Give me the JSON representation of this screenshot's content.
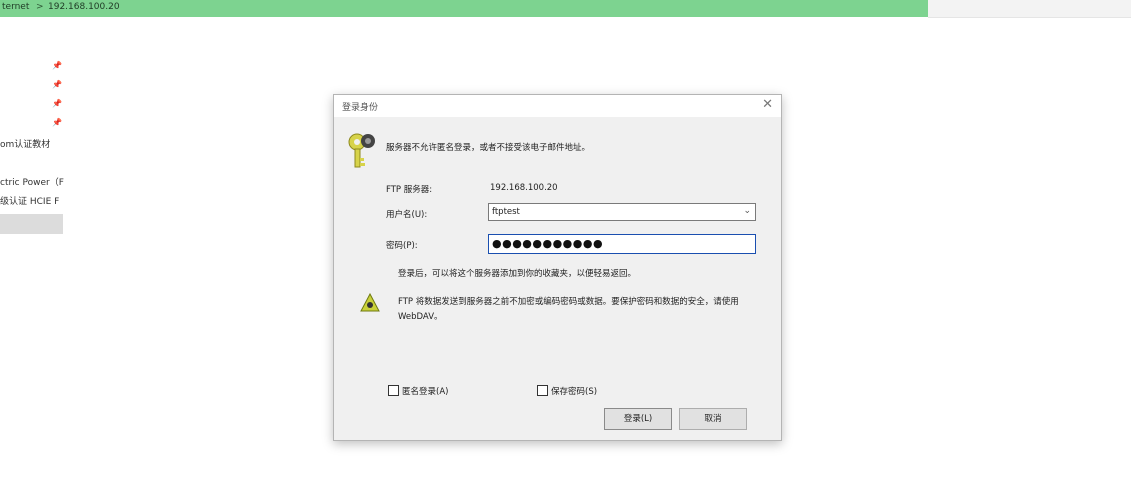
{
  "explorer": {
    "breadcrumb": "ternet",
    "separator": ">",
    "address": "192.168.100.20",
    "nav": [
      {
        "label": "om认证教材"
      },
      {
        "label": "ctric Power（F"
      },
      {
        "label": "级认证 HCIE F"
      }
    ],
    "pin_icon": "pin-icon"
  },
  "dialog": {
    "title": "登录身份",
    "close_icon": "close-icon",
    "message": "服务器不允许匿名登录，或者不接受该电子邮件地址。",
    "server_label": "FTP 服务器:",
    "server_value": "192.168.100.20",
    "username_label": "用户名(U):",
    "username_value": "ftptest",
    "password_label": "密码(P):",
    "password_value": "●●●●●●●●●●●",
    "note_login": "登录后，可以将这个服务器添加到你的收藏夹，以便轻易返回。",
    "note_security": "FTP 将数据发送到服务器之前不加密或编码密码或数据。要保护密码和数据的安全，请使用 WebDAV。",
    "anonymous_label": "匿名登录(A)",
    "save_password_label": "保存密码(S)",
    "login_button": "登录(L)",
    "cancel_button": "取消"
  },
  "colors": {
    "address_bar": "#7dd390",
    "dialog_bg": "#f0f0f0",
    "button_bg": "#e1e1e1",
    "password_focus": "#1a4fb0"
  }
}
